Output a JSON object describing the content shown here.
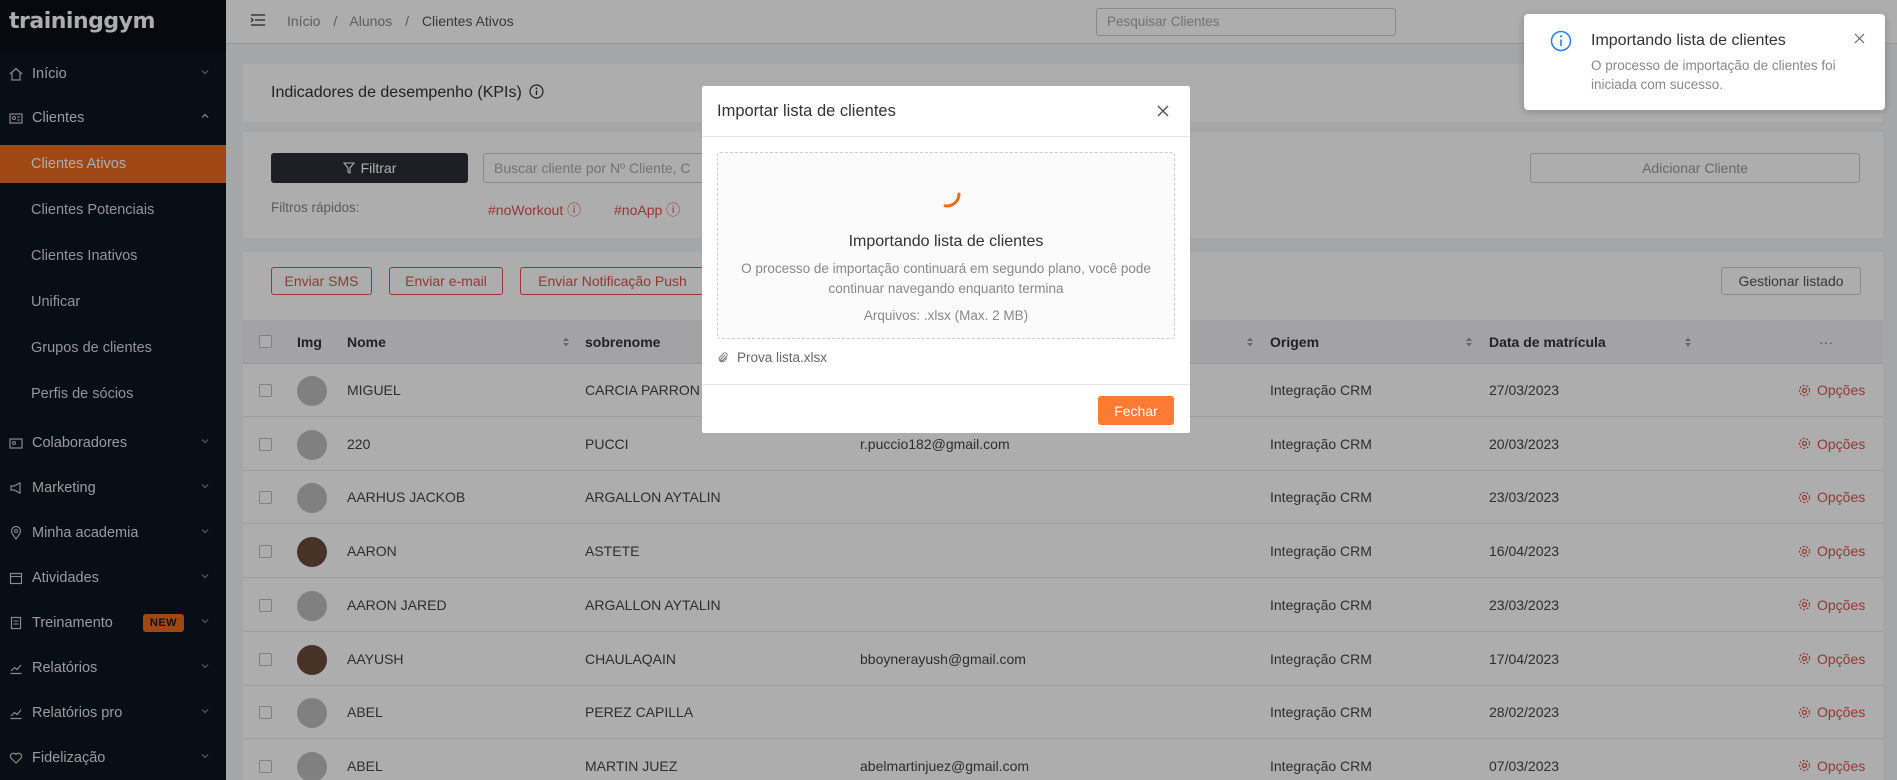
{
  "app": {
    "logo": "traininggym"
  },
  "sidebar": {
    "items": [
      {
        "label": "Início",
        "icon": "home-icon"
      },
      {
        "label": "Clientes",
        "icon": "id-card-icon"
      },
      {
        "label": "Colaboradores",
        "icon": "id-badge-icon"
      },
      {
        "label": "Marketing",
        "icon": "megaphone-icon"
      },
      {
        "label": "Minha academia",
        "icon": "location-pin-icon"
      },
      {
        "label": "Atividades",
        "icon": "calendar-icon"
      },
      {
        "label": "Treinamento",
        "icon": "clipboard-icon",
        "badge": "NEW"
      },
      {
        "label": "Relatórios",
        "icon": "trend-chart-icon"
      },
      {
        "label": "Relatórios pro",
        "icon": "trend-chart-icon"
      },
      {
        "label": "Fidelização",
        "icon": "heart-icon"
      }
    ],
    "subitems": [
      "Clientes Ativos",
      "Clientes Potenciais",
      "Clientes Inativos",
      "Unificar",
      "Grupos de clientes",
      "Perfis de sócios"
    ]
  },
  "topbar": {
    "breadcrumbs": [
      "Início",
      "/",
      "Alunos",
      "/",
      "Clientes Ativos"
    ],
    "search_placeholder": "Pesquisar Clientes"
  },
  "kpi": {
    "title": "Indicadores de desempenho (KPIs)"
  },
  "filters": {
    "filter_button": "Filtrar",
    "search_placeholder": "Buscar cliente por Nº Cliente, C",
    "add_button": "Adicionar Cliente",
    "quick_label": "Filtros rápidos:",
    "quick": [
      "#noWorkout",
      "#noApp"
    ]
  },
  "actions": {
    "sms": "Enviar SMS",
    "email": "Enviar e-mail",
    "push": "Enviar Notificação Push",
    "manage": "Gestionar listado"
  },
  "table": {
    "headers": {
      "img": "Img",
      "nome": "Nome",
      "sobrenome": "sobrenome",
      "origem": "Origem",
      "data": "Data de matrícula",
      "more": "···"
    },
    "options_label": "Opções",
    "rows": [
      {
        "nome": "MIGUEL",
        "sobrenome": "CARCIA PARRON",
        "email": "",
        "origem": "Integração CRM",
        "data": "27/03/2023",
        "photo": false
      },
      {
        "nome": "220",
        "sobrenome": "PUCCI",
        "email": "r.puccio182@gmail.com",
        "origem": "Integração CRM",
        "data": "20/03/2023",
        "photo": false
      },
      {
        "nome": "AARHUS JACKOB",
        "sobrenome": "ARGALLON AYTALIN",
        "email": "",
        "origem": "Integração CRM",
        "data": "23/03/2023",
        "photo": false
      },
      {
        "nome": "AARON",
        "sobrenome": "ASTETE",
        "email": "",
        "origem": "Integração CRM",
        "data": "16/04/2023",
        "photo": true
      },
      {
        "nome": "AARON JARED",
        "sobrenome": "ARGALLON AYTALIN",
        "email": "",
        "origem": "Integração CRM",
        "data": "23/03/2023",
        "photo": false
      },
      {
        "nome": "AAYUSH",
        "sobrenome": "CHAULAQAIN",
        "email": "bboynerayush@gmail.com",
        "origem": "Integração CRM",
        "data": "17/04/2023",
        "photo": true
      },
      {
        "nome": "ABEL",
        "sobrenome": "PEREZ CAPILLA",
        "email": "",
        "origem": "Integração CRM",
        "data": "28/02/2023",
        "photo": false
      },
      {
        "nome": "ABEL",
        "sobrenome": "MARTIN JUEZ",
        "email": "abelmartinjuez@gmail.com",
        "origem": "Integração CRM",
        "data": "07/03/2023",
        "photo": false
      }
    ]
  },
  "modal": {
    "title": "Importar lista de clientes",
    "dropzone_title": "Importando lista de clientes",
    "dropzone_desc": "O processo de importação continuará em segundo plano, você pode continuar navegando enquanto termina",
    "dropzone_files": "Arquivos: .xlsx (Max. 2 MB)",
    "file_name": "Prova lista.xlsx",
    "close_button": "Fechar"
  },
  "toast": {
    "title": "Importando lista de clientes",
    "message": "O processo de importação de clientes foi iniciada com sucesso."
  },
  "colors": {
    "accent": "#ea6a1f",
    "button_orange": "#ff7a32",
    "danger_text": "#d9534f",
    "sidebar_bg": "#0d1520"
  }
}
